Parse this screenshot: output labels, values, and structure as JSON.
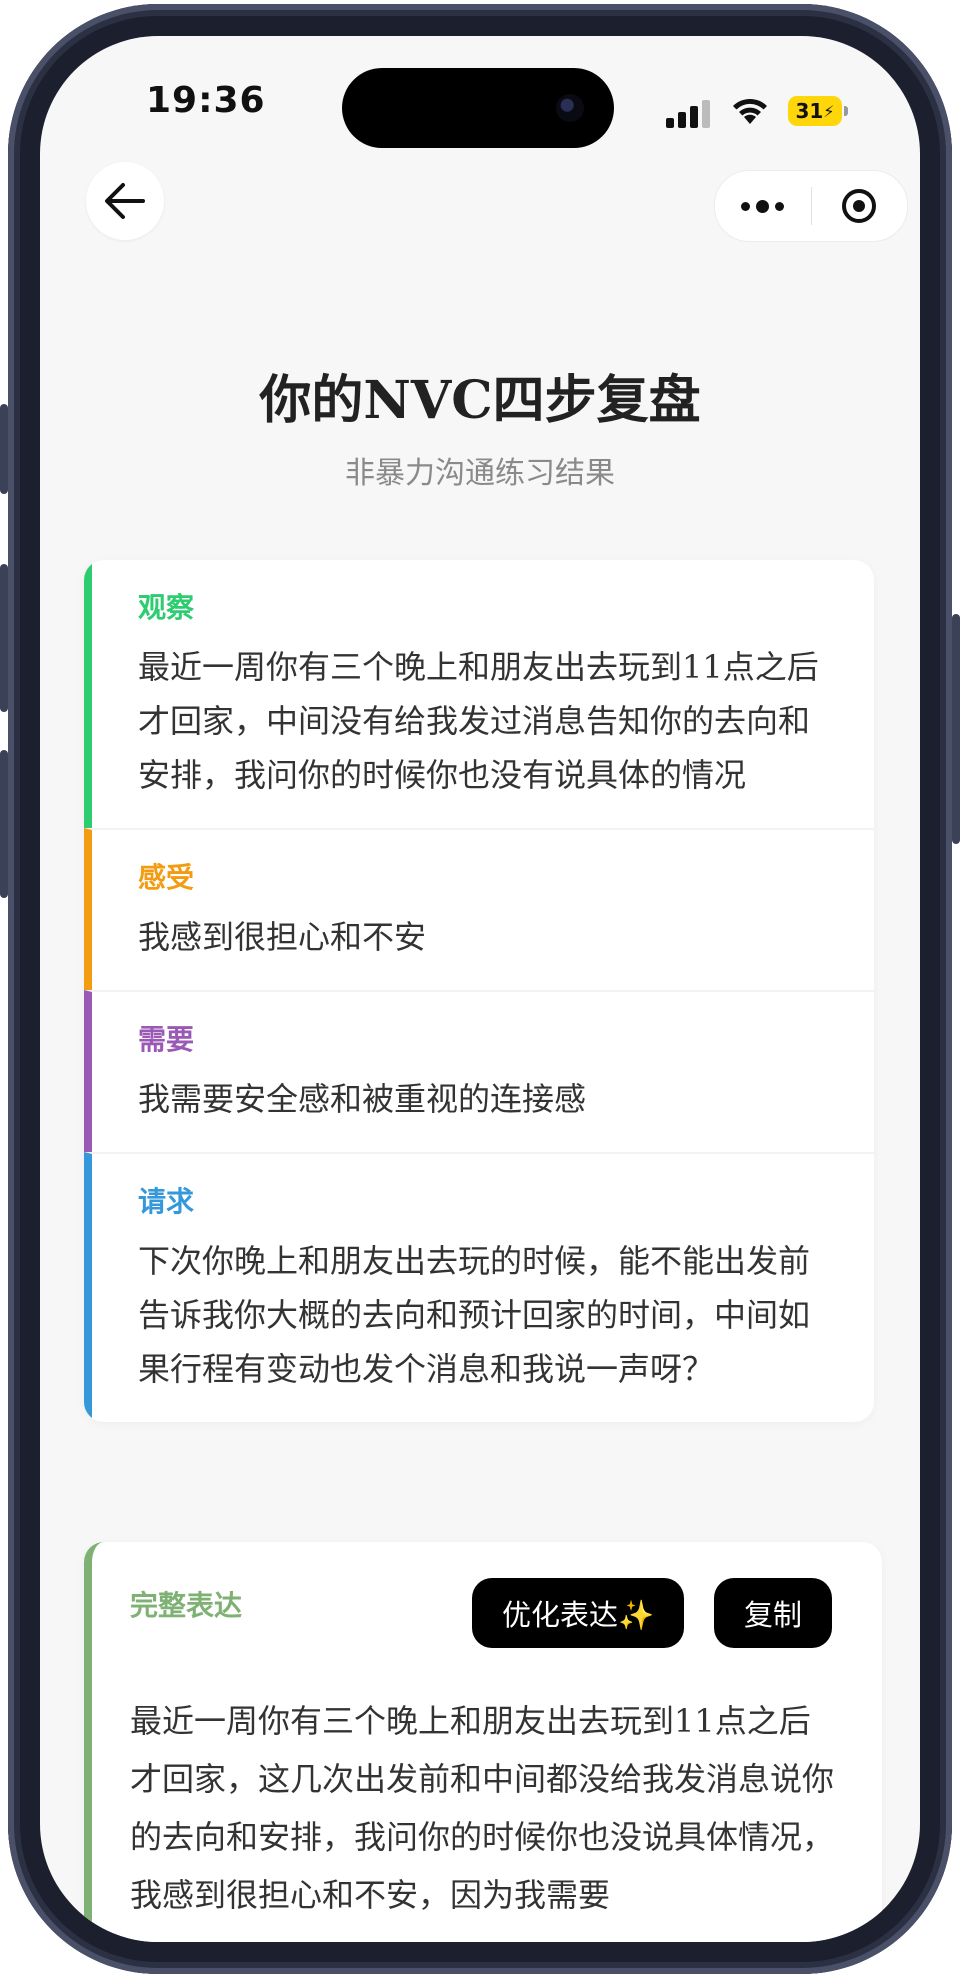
{
  "status": {
    "time": "19:36",
    "battery": "31"
  },
  "header": {
    "title": "你的NVC四步复盘",
    "subtitle": "非暴力沟通练习结果"
  },
  "steps": [
    {
      "label": "观察",
      "color": "#2ecc71",
      "text": "最近一周你有三个晚上和朋友出去玩到11点之后才回家，中间没有给我发过消息告知你的去向和安排，我问你的时候你也没有说具体的情况"
    },
    {
      "label": "感受",
      "color": "#f39c12",
      "text": "我感到很担心和不安"
    },
    {
      "label": "需要",
      "color": "#9b59b6",
      "text": "我需要安全感和被重视的连接感"
    },
    {
      "label": "请求",
      "color": "#3498db",
      "text": "下次你晚上和朋友出去玩的时候，能不能出发前告诉我你大概的去向和预计回家的时间，中间如果行程有变动也发个消息和我说一声呀？"
    }
  ],
  "full": {
    "label": "完整表达",
    "optimize_button": "优化表达✨",
    "copy_button": "复制",
    "text": "最近一周你有三个晚上和朋友出去玩到11点之后才回家，这几次出发前和中间都没给我发消息说你的去向和安排，我问你的时候你也没说具体情况，我感到很担心和不安，因为我需要"
  }
}
